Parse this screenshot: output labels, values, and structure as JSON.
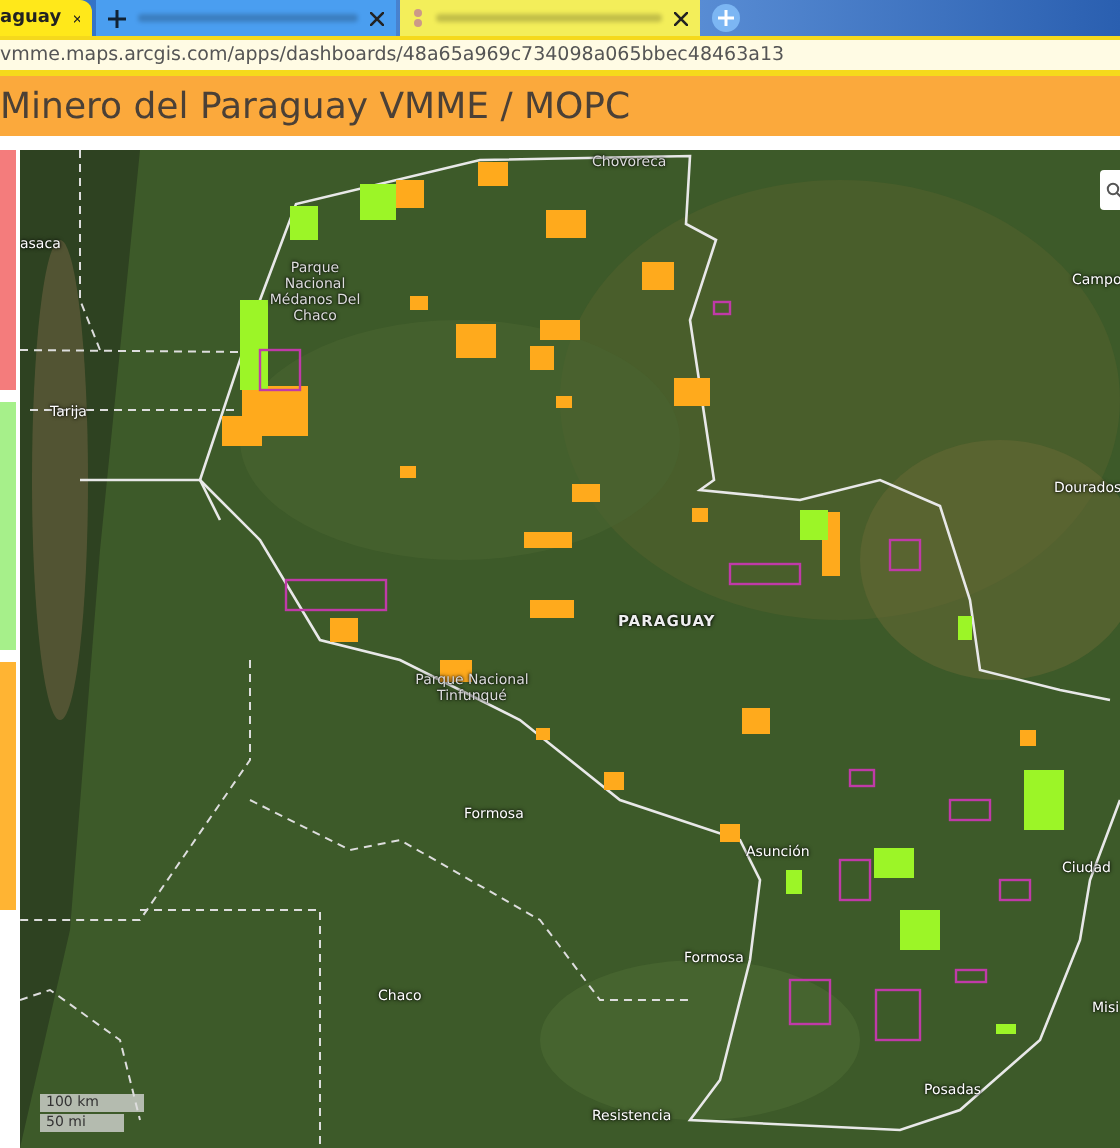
{
  "browser": {
    "tabs": [
      {
        "label": "aguay",
        "selected": true,
        "color": "#ffe81a"
      },
      {
        "selected": false,
        "color": "#4a9ef0"
      },
      {
        "selected": false,
        "color": "#f3ee5a"
      }
    ],
    "url": "vmme.maps.arcgis.com/apps/dashboards/48a65a969c734098a065bbec48463a13"
  },
  "header": {
    "title": "Minero del Paraguay VMME / MOPC"
  },
  "map": {
    "labels": [
      {
        "text": "asaca",
        "kind": "place"
      },
      {
        "text": "Tarija",
        "kind": "place"
      },
      {
        "text": "Chovoreca",
        "kind": "park"
      },
      {
        "text": "Parque Nacional Médanos Del Chaco",
        "kind": "park"
      },
      {
        "text": "Campo",
        "kind": "place"
      },
      {
        "text": "Dourados",
        "kind": "place"
      },
      {
        "text": "PARAGUAY",
        "kind": "country"
      },
      {
        "text": "Parque Nacional Tinfunqué",
        "kind": "park"
      },
      {
        "text": "Formosa",
        "kind": "place"
      },
      {
        "text": "Chaco",
        "kind": "place"
      },
      {
        "text": "Asunción",
        "kind": "place"
      },
      {
        "text": "Ciudad",
        "kind": "place"
      },
      {
        "text": "Formosa",
        "kind": "place"
      },
      {
        "text": "Misi",
        "kind": "place"
      },
      {
        "text": "Posadas",
        "kind": "place"
      },
      {
        "text": "Resistencia",
        "kind": "place"
      }
    ],
    "scale": [
      "100 km",
      "50 mi"
    ]
  }
}
